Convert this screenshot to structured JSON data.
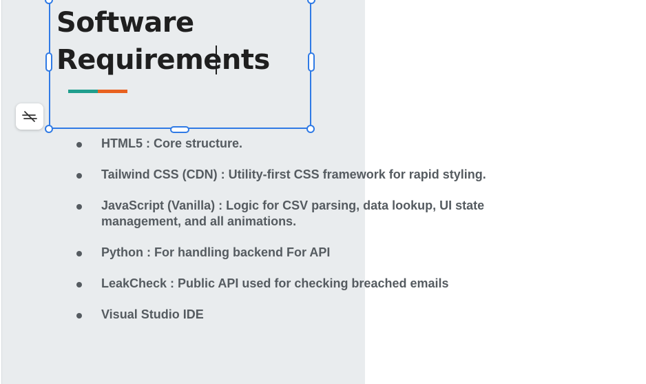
{
  "slide": {
    "title_lines": [
      "Software",
      "Requirements"
    ],
    "accent_colors": {
      "teal": "#1f9e8d",
      "orange": "#e8611f"
    },
    "selection_color": "#2f7ae5"
  },
  "toolbar": {
    "float_button_icon": "crossed-lines-icon"
  },
  "requirements": [
    "HTML5 : Core structure.",
    "Tailwind CSS (CDN) : Utility-first CSS framework for rapid styling.",
    "JavaScript (Vanilla) : Logic for CSV parsing, data lookup, UI state management, and all animations.",
    "Python : For handling backend For API",
    "LeakCheck : Public API used for checking breached emails",
    "Visual Studio IDE"
  ]
}
